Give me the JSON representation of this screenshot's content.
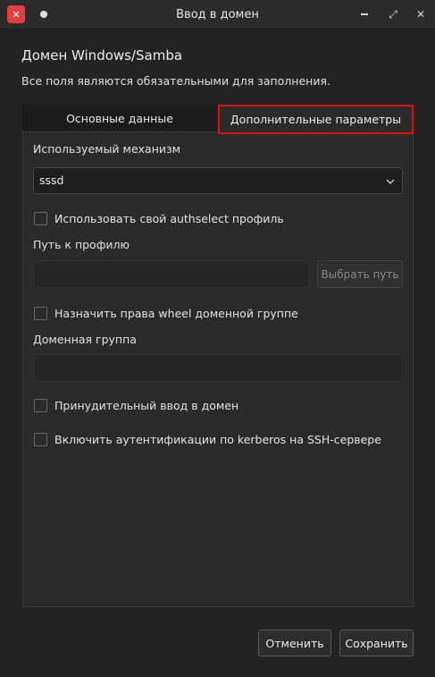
{
  "window": {
    "title": "Ввод в домен",
    "app_icon_glyph": "✕",
    "maximize_glyph": "⤢",
    "close_glyph": "✕"
  },
  "header": {
    "heading": "Домен Windows/Samba",
    "subheading": "Все поля являются обязательными для заполнения."
  },
  "tabs": [
    {
      "label": "Основные данные",
      "active": false
    },
    {
      "label": "Дополнительные параметры",
      "active": true
    }
  ],
  "form": {
    "mechanism_label": "Используемый механизм",
    "mechanism_value": "sssd",
    "authselect_checkbox": {
      "label": "Использовать свой authselect профиль",
      "checked": false
    },
    "profile_path_label": "Путь к профилю",
    "profile_path_value": "",
    "choose_path_button": "Выбрать путь",
    "wheel_checkbox": {
      "label": "Назначить права wheel доменной группе",
      "checked": false
    },
    "domain_group_label": "Доменная группа",
    "domain_group_value": "",
    "force_join_checkbox": {
      "label": "Принудительный ввод в домен",
      "checked": false
    },
    "kerberos_checkbox": {
      "label": "Включить аутентификации по kerberos на SSH-сервере",
      "checked": false
    }
  },
  "footer": {
    "cancel_label": "Отменить",
    "save_label": "Сохранить"
  },
  "colors": {
    "background": "#232323",
    "accent_highlight": "#e01010",
    "app_icon": "#e04040"
  }
}
